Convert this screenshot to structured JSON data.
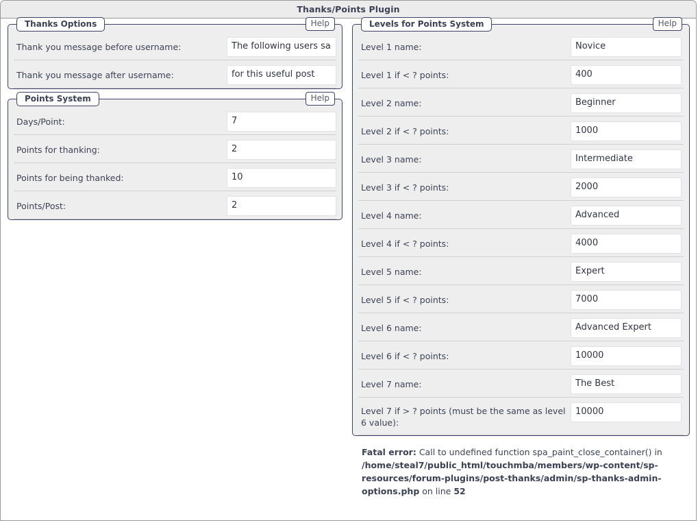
{
  "window": {
    "title": "Thanks/Points Plugin"
  },
  "help_label": "Help",
  "panels": {
    "thanks_options": {
      "legend": "Thanks Options",
      "help": "Help",
      "rows": [
        {
          "label": "Thank you message before username:",
          "value": "The following users sa"
        },
        {
          "label": "Thank you message after username:",
          "value": "for this useful post"
        }
      ]
    },
    "points_system": {
      "legend": "Points System",
      "help": "Help",
      "rows": [
        {
          "label": "Days/Point:",
          "value": "7"
        },
        {
          "label": "Points for thanking:",
          "value": "2"
        },
        {
          "label": "Points for being thanked:",
          "value": "10"
        },
        {
          "label": "Points/Post:",
          "value": "2"
        }
      ]
    },
    "levels_for_points_system": {
      "legend": "Levels for Points System",
      "help": "Help",
      "rows": [
        {
          "label": "Level 1 name:",
          "value": "Novice"
        },
        {
          "label": "Level 1 if < ? points:",
          "value": "400"
        },
        {
          "label": "Level 2 name:",
          "value": "Beginner"
        },
        {
          "label": "Level 2 if < ? points:",
          "value": "1000"
        },
        {
          "label": "Level 3 name:",
          "value": "Intermediate"
        },
        {
          "label": "Level 3 if < ? points:",
          "value": "2000"
        },
        {
          "label": "Level 4 name:",
          "value": "Advanced"
        },
        {
          "label": "Level 4 if < ? points:",
          "value": "4000"
        },
        {
          "label": "Level 5 name:",
          "value": "Expert"
        },
        {
          "label": "Level 5 if < ? points:",
          "value": "7000"
        },
        {
          "label": "Level 6 name:",
          "value": "Advanced Expert"
        },
        {
          "label": "Level 6 if < ? points:",
          "value": "10000"
        },
        {
          "label": "Level 7 name:",
          "value": "The Best"
        },
        {
          "label": "Level 7 if > ? points (must be the same as level 6 value):",
          "value": "10000",
          "tall": true
        }
      ]
    }
  },
  "fatal_error": {
    "prefix": "Fatal error:",
    "message_part1": " Call to undefined function spa_paint_close_container() in ",
    "path": "/home/steal7/public_html/touchmba/members/wp-content/sp-resources/forum-plugins/post-thanks/admin/sp-thanks-admin-options.php",
    "message_part2": " on line ",
    "line": "52"
  },
  "colors": {
    "panel_border": "#3c4265",
    "panel_bg": "#eeeeee",
    "titlebar_bg": "#ececec",
    "text": "#3c4256",
    "separator": "#cfcfcf",
    "input_border": "#e2e2e2"
  }
}
